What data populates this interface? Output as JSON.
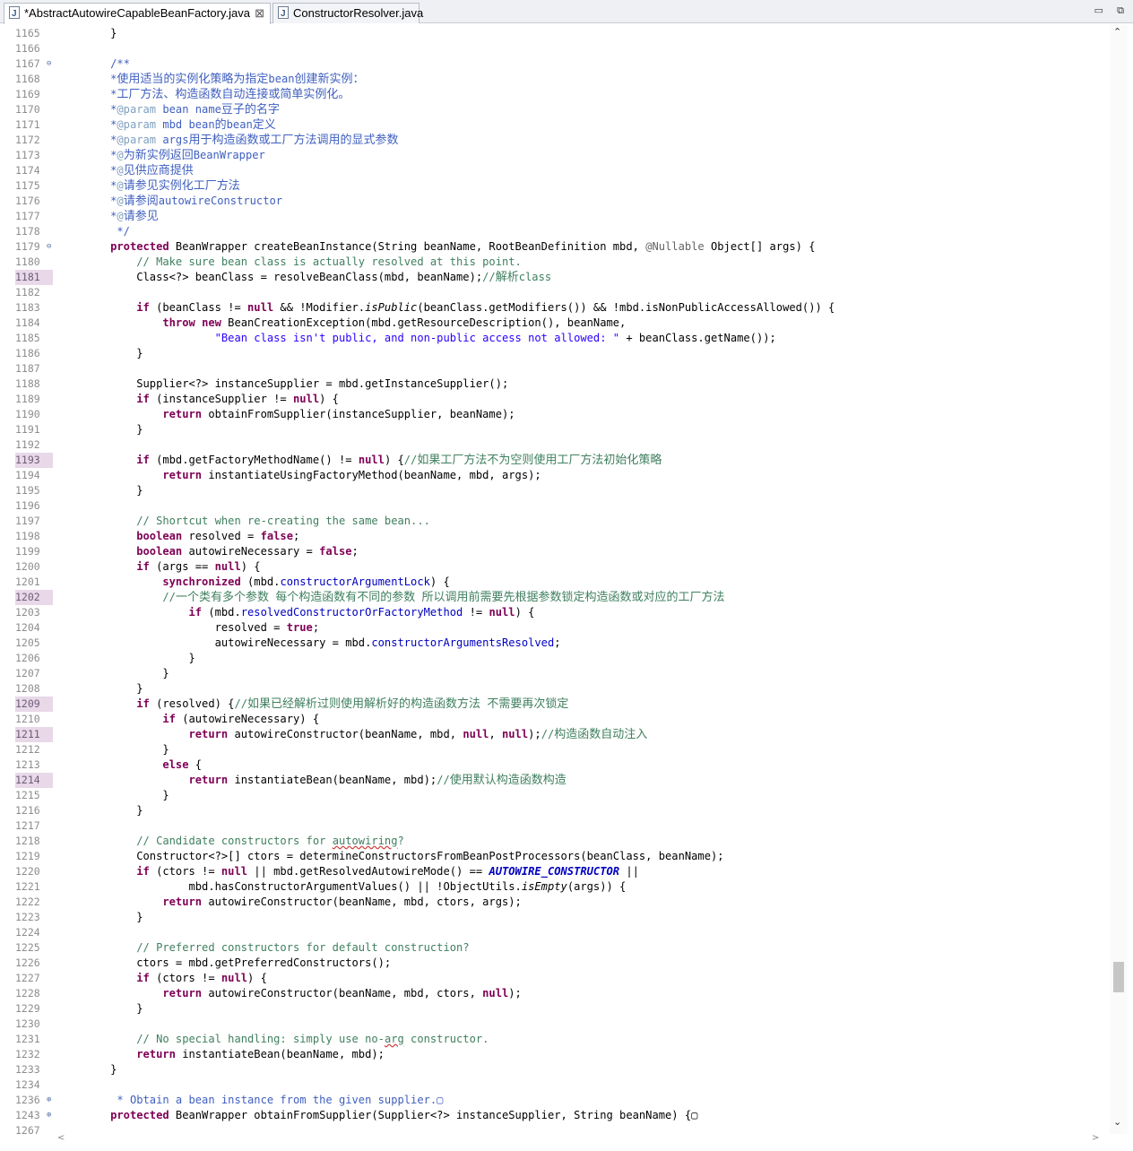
{
  "tabs": [
    {
      "label": "*AbstractAutowireCapableBeanFactory.java",
      "close": "⊠",
      "active": true
    },
    {
      "label": "ConstructorResolver.java",
      "active": false
    }
  ],
  "window_buttons": {
    "minimize": "▭",
    "restore": "⧉"
  },
  "scroll": {
    "up": "⌃",
    "down": "⌄",
    "left": "<",
    "right": ">"
  },
  "lines": [
    {
      "n": "1165",
      "code": "    }"
    },
    {
      "n": "1166",
      "code": ""
    },
    {
      "n": "1167",
      "fold": "⊖",
      "code": "    /**"
    },
    {
      "n": "1168",
      "code": "    *使用适当的实例化策略为指定bean创建新实例："
    },
    {
      "n": "1169",
      "code": "    *工厂方法、构造函数自动连接或简单实例化。"
    },
    {
      "n": "1170",
      "code": "    *@param bean name豆子的名字"
    },
    {
      "n": "1171",
      "code": "    *@param mbd bean的bean定义"
    },
    {
      "n": "1172",
      "code": "    *@param args用于构造函数或工厂方法调用的显式参数"
    },
    {
      "n": "1173",
      "code": "    *@为新实例返回BeanWrapper"
    },
    {
      "n": "1174",
      "code": "    *@见供应商提供"
    },
    {
      "n": "1175",
      "code": "    *@请参见实例化工厂方法"
    },
    {
      "n": "1176",
      "code": "    *@请参阅autowireConstructor"
    },
    {
      "n": "1177",
      "code": "    *@请参见"
    },
    {
      "n": "1178",
      "code": "     */"
    },
    {
      "n": "1179",
      "fold": "⊖",
      "code": "    protected BeanWrapper createBeanInstance(String beanName, RootBeanDefinition mbd, @Nullable Object[] args) {"
    },
    {
      "n": "1180",
      "code": "        // Make sure bean class is actually resolved at this point."
    },
    {
      "n": "1181",
      "hl": true,
      "code": "        Class<?> beanClass = resolveBeanClass(mbd, beanName);//解析class"
    },
    {
      "n": "1182",
      "code": ""
    },
    {
      "n": "1183",
      "code": "        if (beanClass != null && !Modifier.isPublic(beanClass.getModifiers()) && !mbd.isNonPublicAccessAllowed()) {"
    },
    {
      "n": "1184",
      "code": "            throw new BeanCreationException(mbd.getResourceDescription(), beanName,"
    },
    {
      "n": "1185",
      "code": "                    \"Bean class isn't public, and non-public access not allowed: \" + beanClass.getName());"
    },
    {
      "n": "1186",
      "code": "        }"
    },
    {
      "n": "1187",
      "code": ""
    },
    {
      "n": "1188",
      "code": "        Supplier<?> instanceSupplier = mbd.getInstanceSupplier();"
    },
    {
      "n": "1189",
      "code": "        if (instanceSupplier != null) {"
    },
    {
      "n": "1190",
      "code": "            return obtainFromSupplier(instanceSupplier, beanName);"
    },
    {
      "n": "1191",
      "code": "        }"
    },
    {
      "n": "1192",
      "code": ""
    },
    {
      "n": "1193",
      "hl": true,
      "code": "        if (mbd.getFactoryMethodName() != null) {//如果工厂方法不为空则使用工厂方法初始化策略"
    },
    {
      "n": "1194",
      "code": "            return instantiateUsingFactoryMethod(beanName, mbd, args);"
    },
    {
      "n": "1195",
      "code": "        }"
    },
    {
      "n": "1196",
      "code": ""
    },
    {
      "n": "1197",
      "code": "        // Shortcut when re-creating the same bean..."
    },
    {
      "n": "1198",
      "code": "        boolean resolved = false;"
    },
    {
      "n": "1199",
      "code": "        boolean autowireNecessary = false;"
    },
    {
      "n": "1200",
      "code": "        if (args == null) {"
    },
    {
      "n": "1201",
      "code": "            synchronized (mbd.constructorArgumentLock) {"
    },
    {
      "n": "1202",
      "hl": true,
      "code": "            //一个类有多个参数 每个构造函数有不同的参数 所以调用前需要先根据参数锁定构造函数或对应的工厂方法"
    },
    {
      "n": "1203",
      "code": "                if (mbd.resolvedConstructorOrFactoryMethod != null) {"
    },
    {
      "n": "1204",
      "code": "                    resolved = true;"
    },
    {
      "n": "1205",
      "code": "                    autowireNecessary = mbd.constructorArgumentsResolved;"
    },
    {
      "n": "1206",
      "code": "                }"
    },
    {
      "n": "1207",
      "code": "            }"
    },
    {
      "n": "1208",
      "code": "        }"
    },
    {
      "n": "1209",
      "hl": true,
      "code": "        if (resolved) {//如果已经解析过则使用解析好的构造函数方法 不需要再次锁定"
    },
    {
      "n": "1210",
      "code": "            if (autowireNecessary) {"
    },
    {
      "n": "1211",
      "hl": true,
      "code": "                return autowireConstructor(beanName, mbd, null, null);//构造函数自动注入"
    },
    {
      "n": "1212",
      "code": "            }"
    },
    {
      "n": "1213",
      "code": "            else {"
    },
    {
      "n": "1214",
      "hl": true,
      "code": "                return instantiateBean(beanName, mbd);//使用默认构造函数构造"
    },
    {
      "n": "1215",
      "code": "            }"
    },
    {
      "n": "1216",
      "code": "        }"
    },
    {
      "n": "1217",
      "code": ""
    },
    {
      "n": "1218",
      "code": "        // Candidate constructors for autowiring?"
    },
    {
      "n": "1219",
      "code": "        Constructor<?>[] ctors = determineConstructorsFromBeanPostProcessors(beanClass, beanName);"
    },
    {
      "n": "1220",
      "code": "        if (ctors != null || mbd.getResolvedAutowireMode() == AUTOWIRE_CONSTRUCTOR ||"
    },
    {
      "n": "1221",
      "code": "                mbd.hasConstructorArgumentValues() || !ObjectUtils.isEmpty(args)) {"
    },
    {
      "n": "1222",
      "code": "            return autowireConstructor(beanName, mbd, ctors, args);"
    },
    {
      "n": "1223",
      "code": "        }"
    },
    {
      "n": "1224",
      "code": ""
    },
    {
      "n": "1225",
      "code": "        // Preferred constructors for default construction?"
    },
    {
      "n": "1226",
      "code": "        ctors = mbd.getPreferredConstructors();"
    },
    {
      "n": "1227",
      "code": "        if (ctors != null) {"
    },
    {
      "n": "1228",
      "code": "            return autowireConstructor(beanName, mbd, ctors, null);"
    },
    {
      "n": "1229",
      "code": "        }"
    },
    {
      "n": "1230",
      "code": ""
    },
    {
      "n": "1231",
      "code": "        // No special handling: simply use no-arg constructor."
    },
    {
      "n": "1232",
      "code": "        return instantiateBean(beanName, mbd);"
    },
    {
      "n": "1233",
      "code": "    }"
    },
    {
      "n": "1234",
      "code": ""
    },
    {
      "n": "1236",
      "fold": "⊕",
      "code": "     * Obtain a bean instance from the given supplier.▢"
    },
    {
      "n": "1243",
      "fold": "⊕",
      "code": "    protected BeanWrapper obtainFromSupplier(Supplier<?> instanceSupplier, String beanName) {▢"
    },
    {
      "n": "1267",
      "code": ""
    }
  ]
}
